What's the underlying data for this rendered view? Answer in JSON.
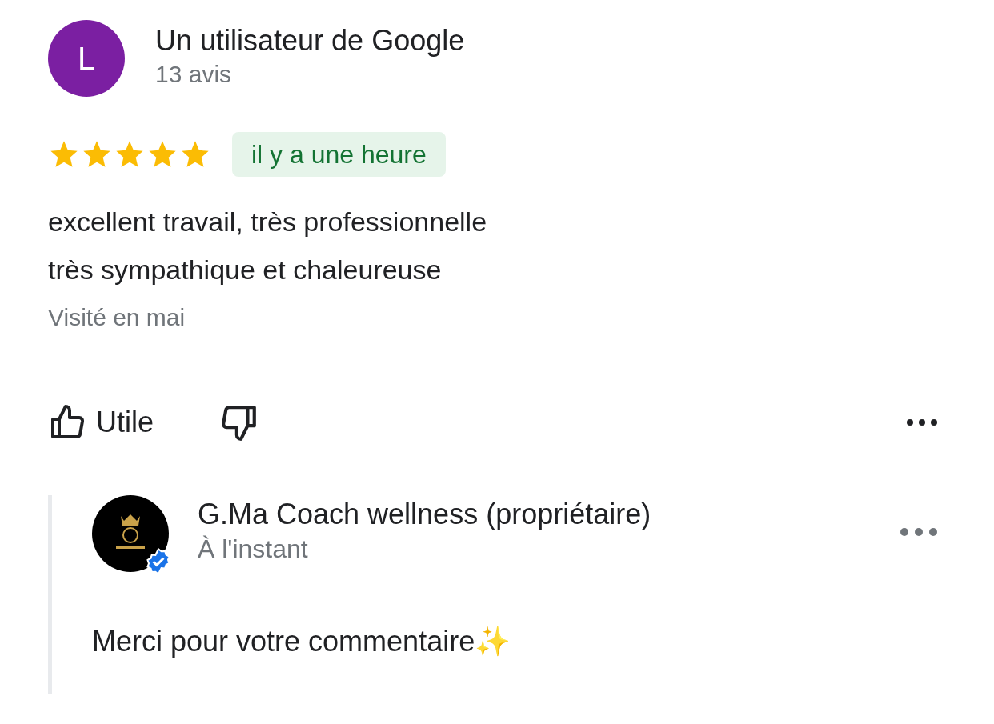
{
  "review": {
    "avatar_letter": "L",
    "author": "Un utilisateur de Google",
    "review_count": "13 avis",
    "stars": 5,
    "time": "il y a une heure",
    "text_lines": [
      "excellent travail, très professionnelle",
      "très sympathique et chaleureuse"
    ],
    "visit": "Visité en mai",
    "helpful_label": "Utile"
  },
  "reply": {
    "author": "G.Ma Coach wellness (propriétaire)",
    "time": "À l'instant",
    "verified": true,
    "text": "Merci pour votre commentaire✨"
  }
}
